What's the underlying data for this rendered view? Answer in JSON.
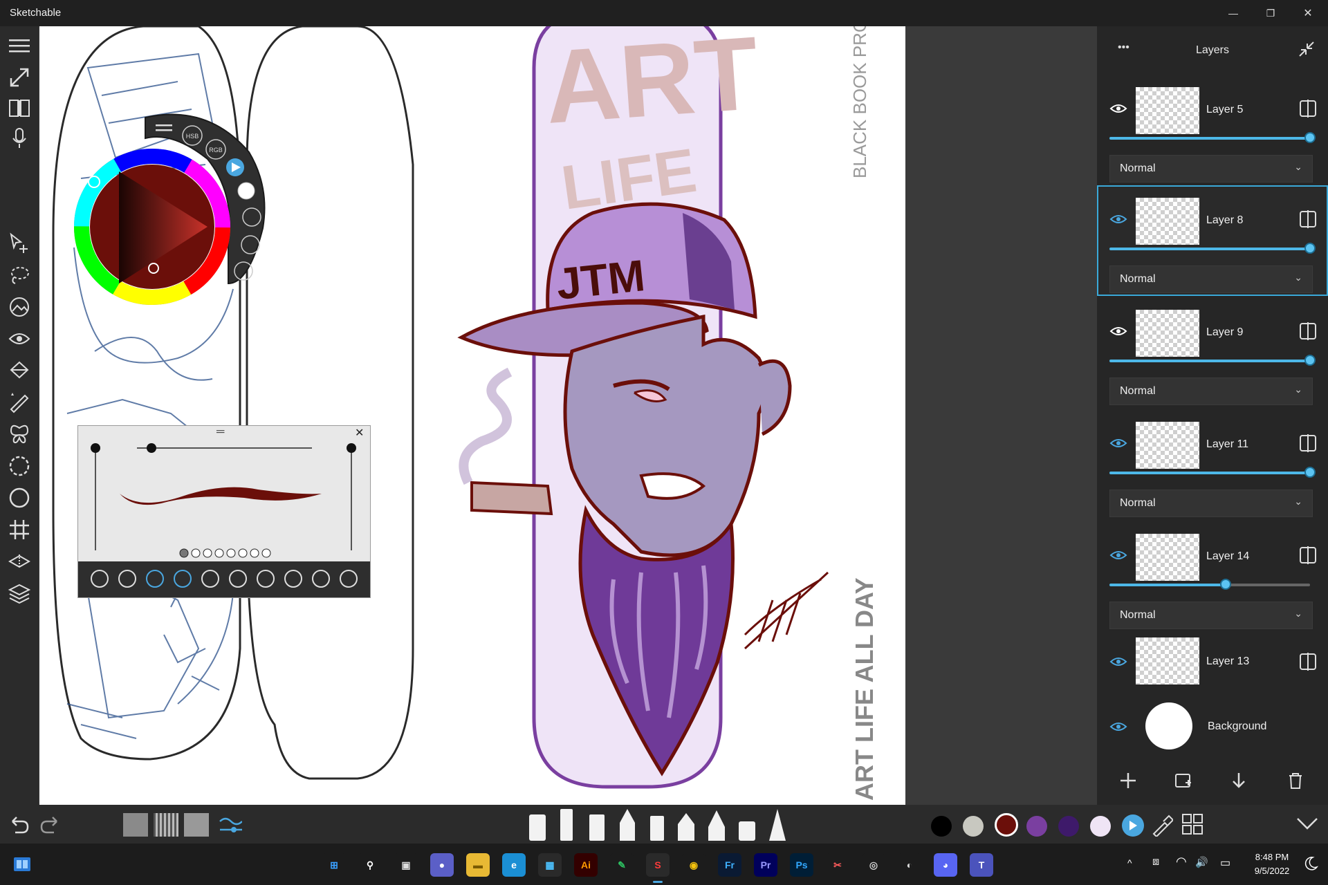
{
  "app": {
    "title": "Sketchable"
  },
  "window_controls": {
    "minimize": "—",
    "maximize": "❐",
    "close": "✕"
  },
  "left_tools": [
    "expand-icon",
    "book-icon",
    "microphone-icon",
    "select-move-icon",
    "lasso-icon",
    "image-icon",
    "eye-icon",
    "fill-bucket-icon",
    "ruler-icon",
    "symmetry-icon",
    "circle-dashed-icon",
    "circle-icon",
    "grid-icon",
    "perspective-icon",
    "layers-icon"
  ],
  "color_picker": {
    "modes": [
      "HSB",
      "RGB"
    ],
    "current_color": "#6b0f0a"
  },
  "brush_panel": {
    "close": "✕",
    "handle": "═",
    "pages": 8,
    "active_page": 1
  },
  "canvas_text": {
    "vertical_top": "BLACK BOOK PROJEC",
    "vertical_bottom": "ART LIFE ALL DAY",
    "board_word1": "ART",
    "board_word2": "LIFE",
    "cap_text": "JTM"
  },
  "layers": {
    "title": "Layers",
    "menu": "•••",
    "items": [
      {
        "name": "Layer 5",
        "blend": "Normal",
        "opacity": 1.0,
        "selected": false
      },
      {
        "name": "Layer 8",
        "blend": "Normal",
        "opacity": 1.0,
        "selected": true
      },
      {
        "name": "Layer 9",
        "blend": "Normal",
        "opacity": 1.0,
        "selected": false
      },
      {
        "name": "Layer 11",
        "blend": "Normal",
        "opacity": 1.0,
        "selected": false
      },
      {
        "name": "Layer 14",
        "blend": "Normal",
        "opacity": 0.6,
        "selected": false
      },
      {
        "name": "Layer 13",
        "blend": "",
        "opacity": null,
        "selected": false
      }
    ],
    "background_label": "Background"
  },
  "bottom_colors": [
    "#000000",
    "#c8c8c0",
    "#6b0f0a",
    "#7a3fa0",
    "#3e1a6a",
    "#efe4f5"
  ],
  "taskbar": {
    "apps": [
      {
        "name": "start",
        "label": "⊞",
        "bg": "#1c1c1c",
        "fg": "#3aa0ff"
      },
      {
        "name": "search",
        "label": "⚲",
        "bg": "#1c1c1c",
        "fg": "#fff"
      },
      {
        "name": "task-view",
        "label": "▣",
        "bg": "#1c1c1c",
        "fg": "#ddd"
      },
      {
        "name": "chat",
        "label": "●",
        "bg": "#5b5fc7",
        "fg": "#fff"
      },
      {
        "name": "file-explorer",
        "label": "▬",
        "bg": "#e8b934",
        "fg": "#7a5b00"
      },
      {
        "name": "edge",
        "label": "e",
        "bg": "#1b8fd4",
        "fg": "#fff"
      },
      {
        "name": "store",
        "label": "▦",
        "bg": "#2a2a2a",
        "fg": "#4cc2ff"
      },
      {
        "name": "illustrator",
        "label": "Ai",
        "bg": "#330000",
        "fg": "#ff9a00"
      },
      {
        "name": "evernote",
        "label": "✎",
        "bg": "#1c1c1c",
        "fg": "#2dbe60"
      },
      {
        "name": "sketchable",
        "label": "S",
        "bg": "#2a2a2a",
        "fg": "#ff3b3b"
      },
      {
        "name": "chrome",
        "label": "◉",
        "bg": "#1c1c1c",
        "fg": "#f4c20d"
      },
      {
        "name": "fresco",
        "label": "Fr",
        "bg": "#0a1a33",
        "fg": "#3fb1ff"
      },
      {
        "name": "premiere",
        "label": "Pr",
        "bg": "#00005b",
        "fg": "#9999ff"
      },
      {
        "name": "photoshop",
        "label": "Ps",
        "bg": "#001e36",
        "fg": "#31a8ff"
      },
      {
        "name": "snip",
        "label": "✂",
        "bg": "#1c1c1c",
        "fg": "#ff5c5c"
      },
      {
        "name": "cloud",
        "label": "◎",
        "bg": "#1c1c1c",
        "fg": "#cfcfcf"
      },
      {
        "name": "obs",
        "label": "◐",
        "bg": "#1c1c1c",
        "fg": "#dddddd"
      },
      {
        "name": "discord",
        "label": "◕",
        "bg": "#5865f2",
        "fg": "#fff"
      },
      {
        "name": "teams",
        "label": "T",
        "bg": "#4b53bc",
        "fg": "#fff"
      }
    ],
    "tray": [
      "^",
      "⧈",
      "◠",
      "🔊",
      "▭"
    ],
    "time": "8:48 PM",
    "date": "9/5/2022"
  }
}
